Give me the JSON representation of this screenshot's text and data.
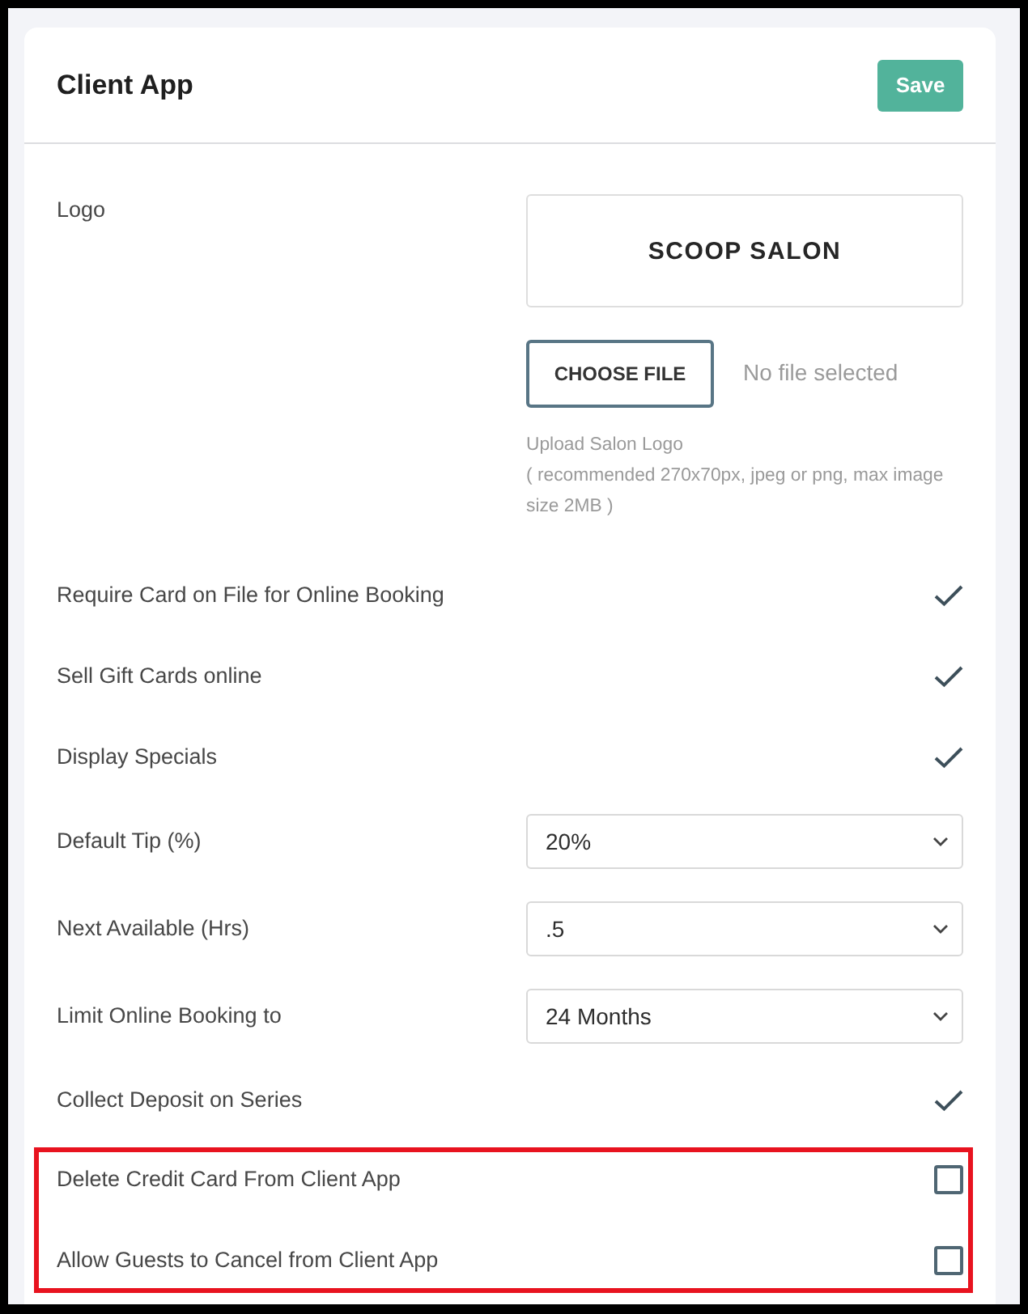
{
  "card": {
    "title": "Client App",
    "save_button": "Save"
  },
  "logo": {
    "label": "Logo",
    "logo_text": "SCOOP SALON",
    "choose_button": "CHOOSE FILE",
    "file_status": "No file selected",
    "hint_lines": [
      "Upload Salon Logo",
      "( recommended 270x70px, jpeg or png, max image size 2MB )"
    ]
  },
  "settings": [
    {
      "kind": "check",
      "label": "Require Card on File for Online Booking",
      "checked": true
    },
    {
      "kind": "check",
      "label": "Sell Gift Cards online",
      "checked": true
    },
    {
      "kind": "check",
      "label": "Display Specials",
      "checked": true
    },
    {
      "kind": "select",
      "label": "Default Tip (%)",
      "value": "20%"
    },
    {
      "kind": "select",
      "label": "Next Available (Hrs)",
      "value": ".5"
    },
    {
      "kind": "select",
      "label": "Limit Online Booking to",
      "value": "24 Months"
    },
    {
      "kind": "check",
      "label": "Collect Deposit on Series",
      "checked": true
    }
  ],
  "highlighted_settings": [
    {
      "kind": "check",
      "label": "Delete Credit Card From Client App",
      "checked": false
    },
    {
      "kind": "check",
      "label": "Allow Guests to Cancel from Client App",
      "checked": false
    }
  ]
}
